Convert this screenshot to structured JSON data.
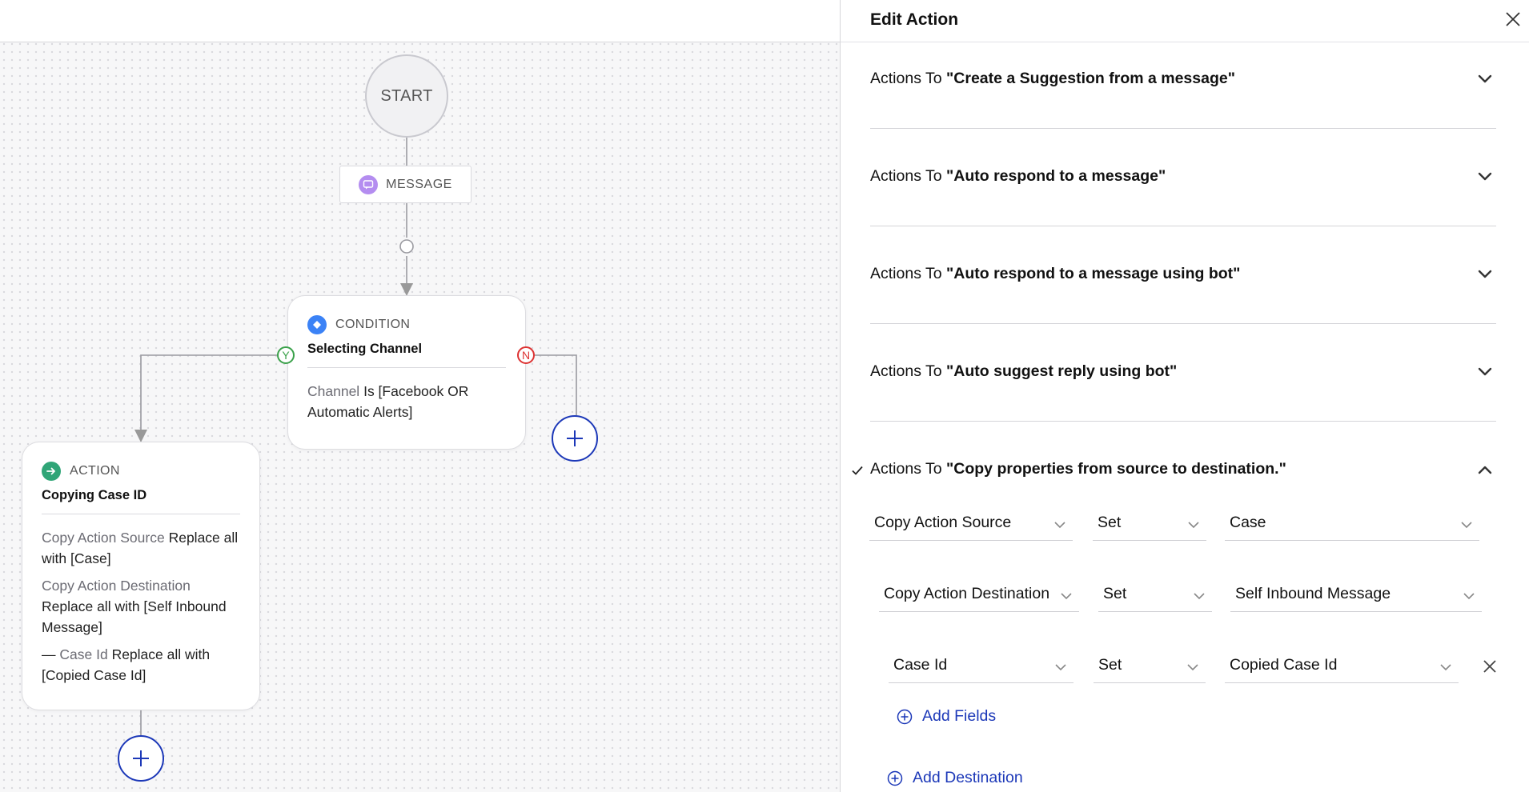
{
  "canvas": {
    "start_label": "START",
    "message_label": "MESSAGE",
    "condition": {
      "type_label": "CONDITION",
      "title": "Selecting Channel",
      "field": "Channel",
      "rule": "Is [Facebook OR Automatic Alerts]",
      "yes_label": "Y",
      "no_label": "N"
    },
    "action": {
      "type_label": "ACTION",
      "title": "Copying Case ID",
      "lines": [
        {
          "field": "Copy Action Source",
          "rule": "Replace all with [Case]"
        },
        {
          "field": "Copy Action Destination",
          "rule": "Replace all with [Self Inbound Message]"
        },
        {
          "prefix": "—",
          "field": "Case Id",
          "rule": "Replace all with [Copied Case Id]"
        }
      ]
    }
  },
  "panel": {
    "title": "Edit Action",
    "accordion_prefix": "Actions To",
    "items": [
      {
        "name": "\"Create a Suggestion from a message\"",
        "expanded": false
      },
      {
        "name": "\"Auto respond to a message\"",
        "expanded": false
      },
      {
        "name": "\"Auto respond to a message using bot\"",
        "expanded": false
      },
      {
        "name": "\"Auto suggest reply using bot\"",
        "expanded": false
      },
      {
        "name": "\"Copy properties from source to destination.\"",
        "expanded": true,
        "checked": true
      }
    ],
    "rows": [
      {
        "field": "Copy Action Source",
        "operator": "Set",
        "value": "Case"
      },
      {
        "field": "Copy Action Destination",
        "operator": "Set",
        "value": "Self Inbound Message"
      },
      {
        "field": "Case Id",
        "operator": "Set",
        "value": "Copied Case Id"
      }
    ],
    "add_fields_label": "Add Fields",
    "add_destination_label": "Add Destination"
  },
  "colors": {
    "link_blue": "#1c38b8",
    "condition_blue": "#3b82f6",
    "action_green": "#2fa577",
    "message_purple": "#b48df0",
    "yes_green": "#3aa14a",
    "no_red": "#dd3333"
  }
}
